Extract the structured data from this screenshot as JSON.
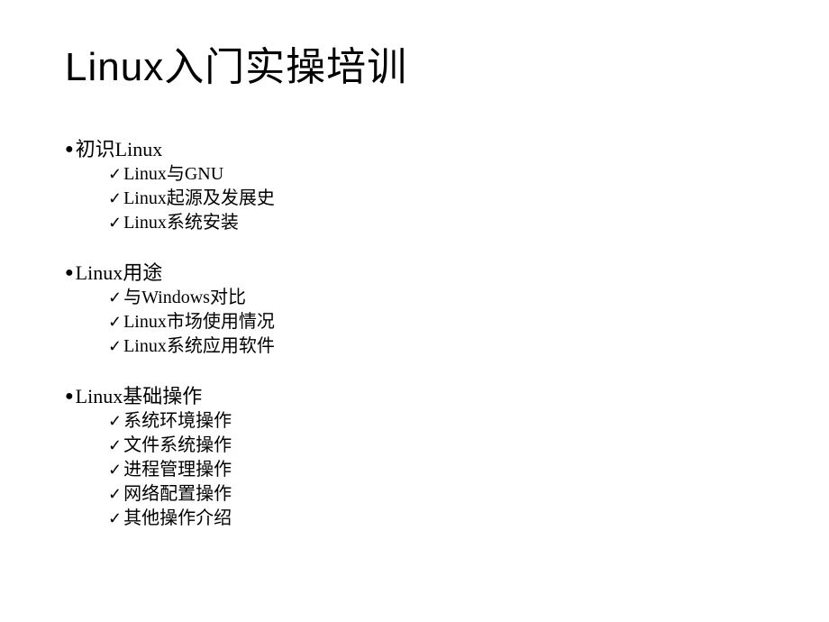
{
  "title": "Linux入门实操培训",
  "sections": [
    {
      "header": "初识Linux",
      "items": [
        "Linux与GNU",
        "Linux起源及发展史",
        "Linux系统安装"
      ]
    },
    {
      "header": "Linux用途",
      "items": [
        "与Windows对比",
        "Linux市场使用情况",
        "Linux系统应用软件"
      ]
    },
    {
      "header": "Linux基础操作",
      "items": [
        "系统环境操作",
        "文件系统操作",
        "进程管理操作",
        "网络配置操作",
        "其他操作介绍"
      ]
    }
  ]
}
